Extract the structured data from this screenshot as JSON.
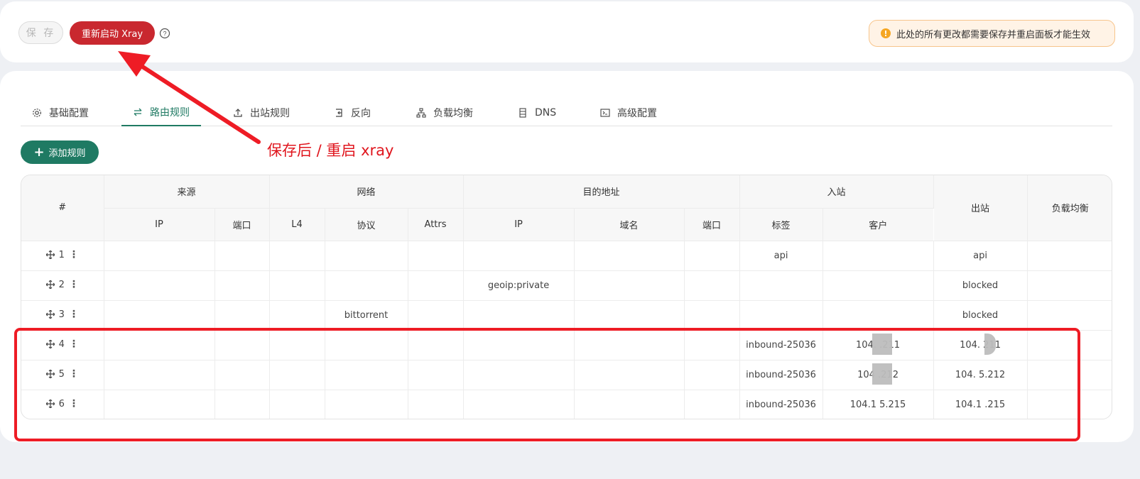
{
  "toolbar": {
    "save_label": "保 存",
    "restart_label": "重新启动 Xray",
    "notice": "此处的所有更改都需要保存并重启面板才能生效"
  },
  "tabs": [
    {
      "label": "基础配置",
      "icon": "gear-icon"
    },
    {
      "label": "路由规则",
      "icon": "swap-icon",
      "active": true
    },
    {
      "label": "出站规则",
      "icon": "upload-icon"
    },
    {
      "label": "反向",
      "icon": "reverse-icon"
    },
    {
      "label": "负载均衡",
      "icon": "cluster-icon"
    },
    {
      "label": "DNS",
      "icon": "dns-icon"
    },
    {
      "label": "高级配置",
      "icon": "code-icon"
    }
  ],
  "add_rule_label": "添加规则",
  "table": {
    "group_headers": {
      "index": "#",
      "source": "来源",
      "network": "网络",
      "destination": "目的地址",
      "inbound": "入站",
      "outbound": "出站",
      "balancer": "负载均衡"
    },
    "sub_headers": {
      "source_ip": "IP",
      "source_port": "端口",
      "l4": "L4",
      "protocol": "协议",
      "attrs": "Attrs",
      "dest_ip": "IP",
      "domain": "域名",
      "dest_port": "端口",
      "tag": "标签",
      "client": "客户"
    },
    "rows": [
      {
        "index": "1",
        "source_ip": "",
        "source_port": "",
        "l4": "",
        "protocol": "",
        "attrs": "",
        "dest_ip": "",
        "domain": "",
        "dest_port": "",
        "tag": "api",
        "client": "",
        "outbound": "api",
        "balancer": ""
      },
      {
        "index": "2",
        "source_ip": "",
        "source_port": "",
        "l4": "",
        "protocol": "",
        "attrs": "",
        "dest_ip": "geoip:private",
        "domain": "",
        "dest_port": "",
        "tag": "",
        "client": "",
        "outbound": "blocked",
        "balancer": ""
      },
      {
        "index": "3",
        "source_ip": "",
        "source_port": "",
        "l4": "",
        "protocol": "bittorrent",
        "attrs": "",
        "dest_ip": "",
        "domain": "",
        "dest_port": "",
        "tag": "",
        "client": "",
        "outbound": "blocked",
        "balancer": ""
      },
      {
        "index": "4",
        "source_ip": "",
        "source_port": "",
        "l4": "",
        "protocol": "",
        "attrs": "",
        "dest_ip": "",
        "domain": "",
        "dest_port": "",
        "tag": "inbound-25036",
        "client": "104.   .211",
        "outbound": "104.   211",
        "balancer": ""
      },
      {
        "index": "5",
        "source_ip": "",
        "source_port": "",
        "l4": "",
        "protocol": "",
        "attrs": "",
        "dest_ip": "",
        "domain": "",
        "dest_port": "",
        "tag": "inbound-25036",
        "client": "104   .212",
        "outbound": "104.   5.212",
        "balancer": ""
      },
      {
        "index": "6",
        "source_ip": "",
        "source_port": "",
        "l4": "",
        "protocol": "",
        "attrs": "",
        "dest_ip": "",
        "domain": "",
        "dest_port": "",
        "tag": "inbound-25036",
        "client": "104.1   5.215",
        "outbound": "104.1   .215",
        "balancer": ""
      }
    ]
  },
  "annotation": {
    "text": "保存后 / 重启 xray"
  },
  "colors": {
    "primary": "#1f7a63",
    "danger": "#c9282f",
    "annotation": "#ee1c25",
    "warning": "#f5a623"
  }
}
